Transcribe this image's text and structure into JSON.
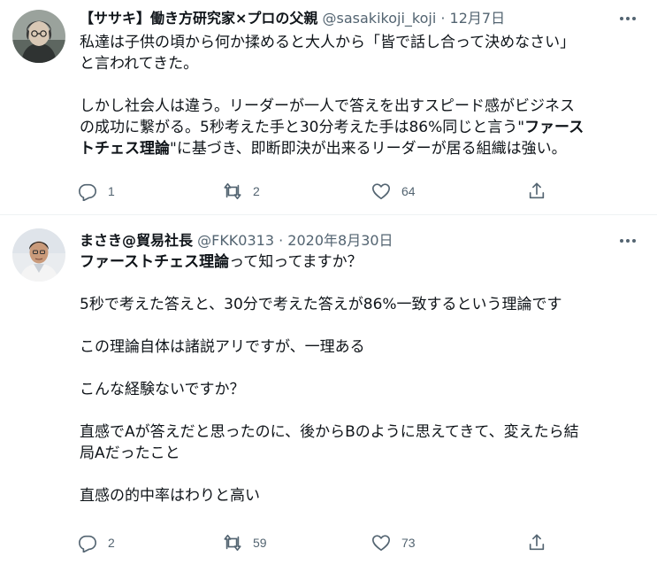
{
  "tweets": [
    {
      "author": {
        "name": "【ササキ】働き方研究家×プロの父親",
        "handle": "@sasakikoji_koji",
        "separator": "·",
        "date": "12月7日"
      },
      "lines": {
        "l1": "私達は子供の頃から何か揉めると大人から「皆で話し合って決めなさい」",
        "l2": "と言われてきた。",
        "l3": "しかし社会人は違う。リーダーが一人で答えを出すスピード感がビジネス",
        "l4a": "の成功に繋がる。5秒考えた手と30分考えた手は86%同じと言う\"",
        "l4b": "ファース",
        "l5a": "トチェス理論",
        "l5b": "\"に基づき、即断即決が出来るリーダーが居る組織は強い。"
      },
      "stats": {
        "replies": "1",
        "retweets": "2",
        "likes": "64"
      }
    },
    {
      "author": {
        "name": "まさき@貿易社長",
        "handle": "@FKK0313",
        "separator": "·",
        "date": "2020年8月30日"
      },
      "lines": {
        "l1a": "ファーストチェス理論",
        "l1b": "って知ってますか？",
        "l2": "5秒で考えた答えと、30分で考えた答えが86%一致するという理論です",
        "l3": "この理論自体は諸説アリですが、一理ある",
        "l4": "こんな経験ないですか？",
        "l5": "直感でAが答えだと思ったのに、後からBのように思えてきて、変えたら結",
        "l6": "局Aだったこと",
        "l7": "直感の的中率はわりと高い"
      },
      "stats": {
        "replies": "2",
        "retweets": "59",
        "likes": "73"
      }
    }
  ],
  "icons": {
    "more": "more-horizontal-icon",
    "reply": "reply-icon",
    "retweet": "retweet-icon",
    "like": "heart-icon",
    "share": "share-icon"
  },
  "colors": {
    "text": "#0f1419",
    "secondary": "#536471",
    "divider": "#eff3f4"
  }
}
